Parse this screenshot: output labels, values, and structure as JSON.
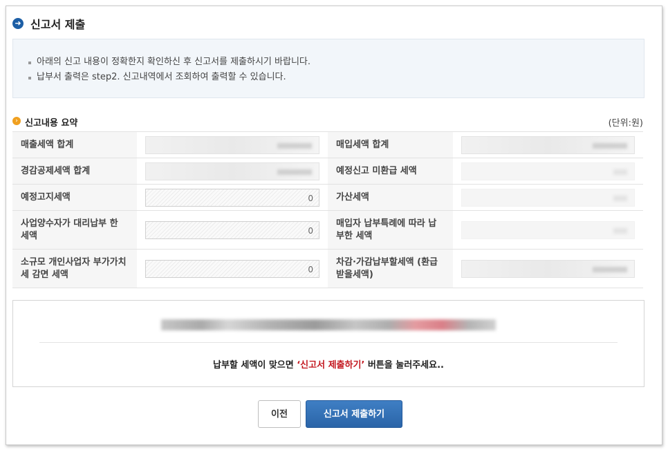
{
  "header": {
    "title": "신고서 제출"
  },
  "notice": {
    "lines": [
      "아래의 신고 내용이 정확한지 확인하신 후 신고서를 제출하시기 바랍니다.",
      "납부서 출력은 step2. 신고내역에서 조회하여 출력할 수 있습니다."
    ]
  },
  "summary": {
    "title": "신고내용 요약",
    "unit": "(단위:원)",
    "rows": [
      {
        "left_label": "매출세액 합계",
        "left_value": "",
        "right_label": "매입세액 합계",
        "right_value": ""
      },
      {
        "left_label": "경감공제세액 합계",
        "left_value": "",
        "right_label": "예정신고 미환급 세액",
        "right_value": ""
      },
      {
        "left_label": "예정고지세액",
        "left_value": "0",
        "right_label": "가산세액",
        "right_value": ""
      },
      {
        "left_label": "사업양수자가 대리납부 한 세액",
        "left_value": "0",
        "right_label": "매입자 납부특례에 따라 납부한 세액",
        "right_value": ""
      },
      {
        "left_label": "소규모 개인사업자 부가가치세 감면 세액",
        "left_value": "0",
        "right_label": "차감·가감납부할세액 (환급받을세액)",
        "right_value": ""
      }
    ]
  },
  "confirm": {
    "message_pre": "납부할 세액이 맞으면 ",
    "message_highlight": "‘신고서 제출하기’",
    "message_post": " 버튼을 눌러주세요.."
  },
  "buttons": {
    "prev": "이전",
    "submit": "신고서 제출하기"
  },
  "colors": {
    "accent": "#2a64a8",
    "highlight": "#c3171f",
    "section_icon": "#f0a020"
  }
}
